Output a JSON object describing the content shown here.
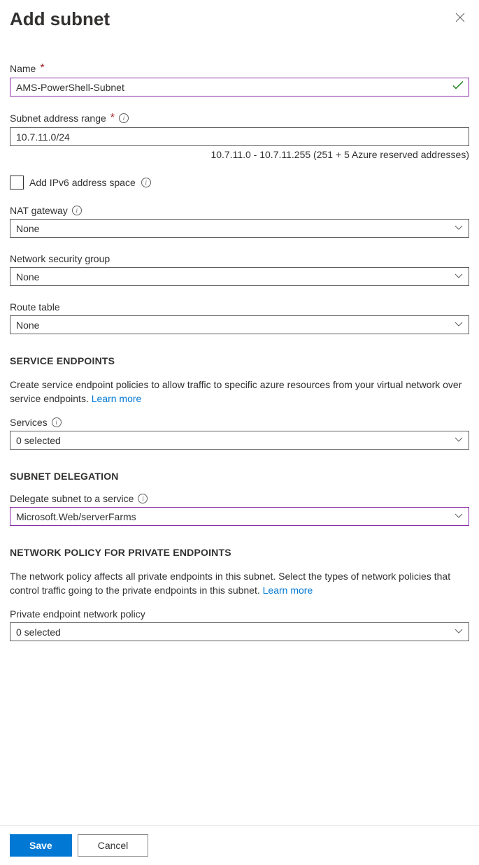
{
  "header": {
    "title": "Add subnet"
  },
  "fields": {
    "name": {
      "label": "Name",
      "value": "AMS-PowerShell-Subnet"
    },
    "addressRange": {
      "label": "Subnet address range",
      "value": "10.7.11.0/24",
      "hint": "10.7.11.0 - 10.7.11.255 (251 + 5 Azure reserved addresses)"
    },
    "ipv6": {
      "label": "Add IPv6 address space"
    },
    "natGateway": {
      "label": "NAT gateway",
      "value": "None"
    },
    "nsg": {
      "label": "Network security group",
      "value": "None"
    },
    "routeTable": {
      "label": "Route table",
      "value": "None"
    },
    "services": {
      "label": "Services",
      "value": "0 selected"
    },
    "delegate": {
      "label": "Delegate subnet to a service",
      "value": "Microsoft.Web/serverFarms"
    },
    "pep": {
      "label": "Private endpoint network policy",
      "value": "0 selected"
    }
  },
  "sections": {
    "serviceEndpoints": {
      "heading": "SERVICE ENDPOINTS",
      "text": "Create service endpoint policies to allow traffic to specific azure resources from your virtual network over service endpoints. ",
      "learnMore": "Learn more"
    },
    "subnetDelegation": {
      "heading": "SUBNET DELEGATION"
    },
    "networkPolicy": {
      "heading": "NETWORK POLICY FOR PRIVATE ENDPOINTS",
      "text": "The network policy affects all private endpoints in this subnet. Select the types of network policies that control traffic going to the private endpoints in this subnet. ",
      "learnMore": "Learn more"
    }
  },
  "footer": {
    "save": "Save",
    "cancel": "Cancel"
  }
}
